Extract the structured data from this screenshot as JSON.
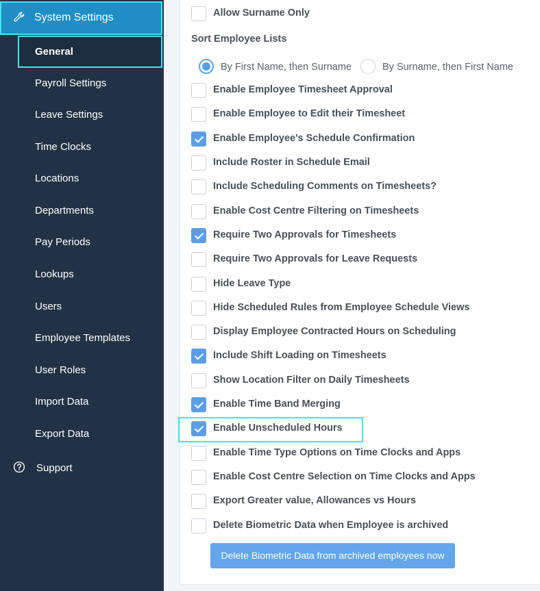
{
  "sidebar": {
    "header": {
      "label": "System Settings",
      "icon": "wrench-icon"
    },
    "items": [
      {
        "label": "General",
        "active": true
      },
      {
        "label": "Payroll Settings"
      },
      {
        "label": "Leave Settings"
      },
      {
        "label": "Time Clocks"
      },
      {
        "label": "Locations"
      },
      {
        "label": "Departments"
      },
      {
        "label": "Pay Periods"
      },
      {
        "label": "Lookups"
      },
      {
        "label": "Users"
      },
      {
        "label": "Employee Templates"
      },
      {
        "label": "User Roles"
      },
      {
        "label": "Import Data"
      },
      {
        "label": "Export Data"
      }
    ],
    "support": {
      "label": "Support",
      "icon": "question-circle-icon"
    }
  },
  "settings": {
    "allow_surname": {
      "label": "Allow Surname Only",
      "checked": false
    },
    "sort_label": "Sort Employee Lists",
    "sort_options": [
      {
        "label": "By First Name, then Surname",
        "selected": true
      },
      {
        "label": "By Surname, then First Name",
        "selected": false
      }
    ],
    "options": [
      {
        "label": "Enable Employee Timesheet Approval",
        "checked": false
      },
      {
        "label": "Enable Employee to Edit their Timesheet",
        "checked": false
      },
      {
        "label": "Enable Employee's Schedule Confirmation",
        "checked": true
      },
      {
        "label": "Include Roster in Schedule Email",
        "checked": false
      },
      {
        "label": "Include Scheduling Comments on Timesheets?",
        "checked": false
      },
      {
        "label": "Enable Cost Centre Filtering on Timesheets",
        "checked": false
      },
      {
        "label": "Require Two Approvals for Timesheets",
        "checked": true
      },
      {
        "label": "Require Two Approvals for Leave Requests",
        "checked": false
      },
      {
        "label": "Hide Leave Type",
        "checked": false
      },
      {
        "label": "Hide Scheduled Rules from Employee Schedule Views",
        "checked": false
      },
      {
        "label": "Display Employee Contracted Hours on Scheduling",
        "checked": false
      },
      {
        "label": "Include Shift Loading on Timesheets",
        "checked": true
      },
      {
        "label": "Show Location Filter on Daily Timesheets",
        "checked": false
      },
      {
        "label": "Enable Time Band Merging",
        "checked": true
      },
      {
        "label": "Enable Unscheduled Hours",
        "checked": true
      },
      {
        "label": "Enable Time Type Options on Time Clocks and Apps",
        "checked": false
      },
      {
        "label": "Enable Cost Centre Selection on Time Clocks and Apps",
        "checked": false
      },
      {
        "label": "Export Greater value, Allowances vs Hours",
        "checked": false
      },
      {
        "label": "Delete Biometric Data when Employee is archived",
        "checked": false
      }
    ],
    "action_button": "Delete Biometric Data from archived employees now"
  },
  "colors": {
    "sidebar_bg": "#223246",
    "header_bg": "#1f8ec6",
    "highlight": "#3ee6ec",
    "accent": "#5b9ee6"
  }
}
